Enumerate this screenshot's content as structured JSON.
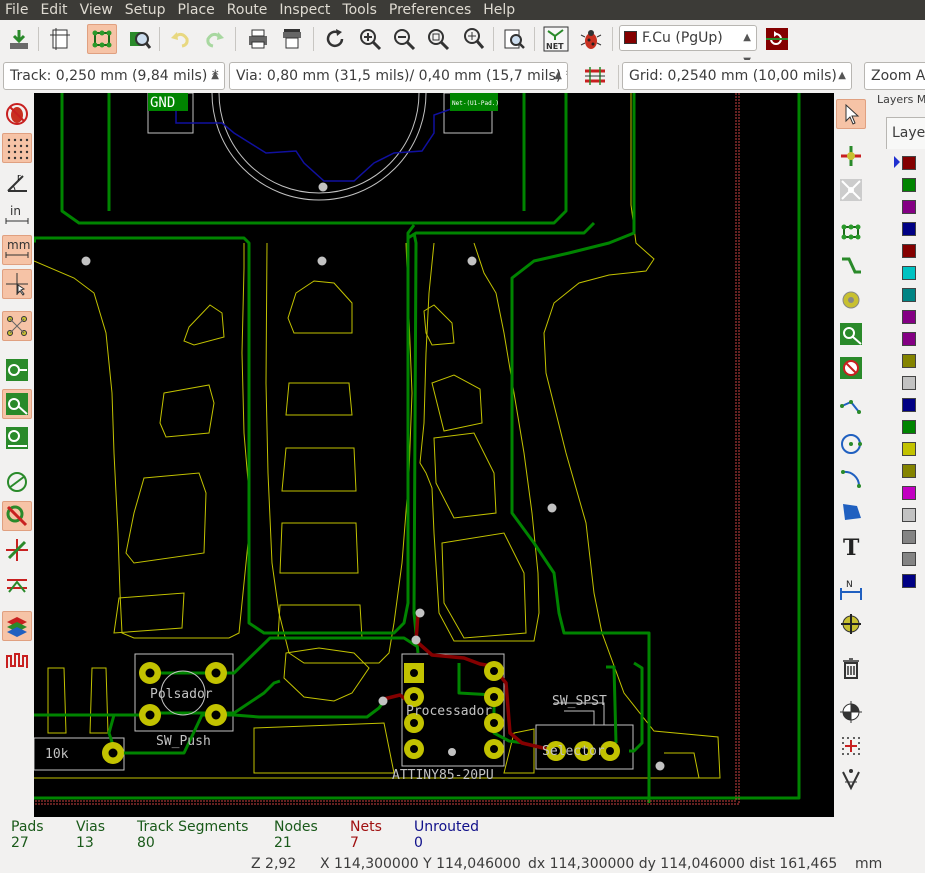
{
  "menu": [
    "File",
    "Edit",
    "View",
    "Setup",
    "Place",
    "Route",
    "Inspect",
    "Tools",
    "Preferences",
    "Help"
  ],
  "toolbar": {
    "active_layer": "F.Cu (PgUp)",
    "active_layer_color": "#840000",
    "icons": [
      "save-board-icon",
      "page-settings-icon",
      "footprint-library-icon",
      "footprint-viewer-icon",
      "undo-icon",
      "redo-icon",
      "print-icon",
      "plot-icon",
      "redraw-icon",
      "zoom-in-icon",
      "zoom-out-icon",
      "zoom-fit-icon",
      "zoom-selection-icon",
      "find-icon",
      "netlist-icon",
      "drc-icon",
      "layer-pair-icon"
    ]
  },
  "toolbar2": {
    "track": "Track: 0,250 mm (9,84 mils) *",
    "via": "Via: 0,80 mm (31,5 mils)/ 0,40 mm (15,7 mils) *",
    "grid": "Grid: 0,2540 mm (10,00 mils)",
    "zoom": "Zoom Au"
  },
  "layers_panel": {
    "title": "Layers M",
    "tab": "Layer",
    "colors": [
      "#840000",
      "#008400",
      "#840084",
      "#000084",
      "#840000",
      "#00c2c2",
      "#008484",
      "#840084",
      "#840084",
      "#848400",
      "#c2c2c2",
      "#000084",
      "#008400",
      "#c2c200",
      "#848400",
      "#c200c2",
      "#c2c2c2",
      "#848484",
      "#848484",
      "#000084"
    ]
  },
  "board": {
    "labels": {
      "gnd": "GND",
      "net_label": "Net-(U1-Pad.)",
      "polsador": "Polsador",
      "sw_push": "SW_Push",
      "r_value": "10k",
      "processador": "Processador",
      "attiny": "ATTINY85-20PU",
      "sw_spst": "SW_SPST",
      "selector": "Selector"
    },
    "colors": {
      "track": "#008400",
      "front_copper": "#840000",
      "edge_cuts": "#c2c200",
      "silkscreen": "#c2c2c2",
      "pad": "#c2c200",
      "back_copper": "#000084"
    }
  },
  "status": {
    "pads_label": "Pads",
    "pads": "27",
    "vias_label": "Vias",
    "vias": "13",
    "tracks_label": "Track Segments",
    "tracks": "80",
    "nodes_label": "Nodes",
    "nodes": "21",
    "nets_label": "Nets",
    "nets": "7",
    "unrouted_label": "Unrouted",
    "unrouted": "0",
    "zoom": "Z 2,92",
    "xy": "X 114,300000  Y 114,046000",
    "dxdy": "dx 114,300000  dy 114,046000  dist 161,465",
    "units": "mm"
  }
}
